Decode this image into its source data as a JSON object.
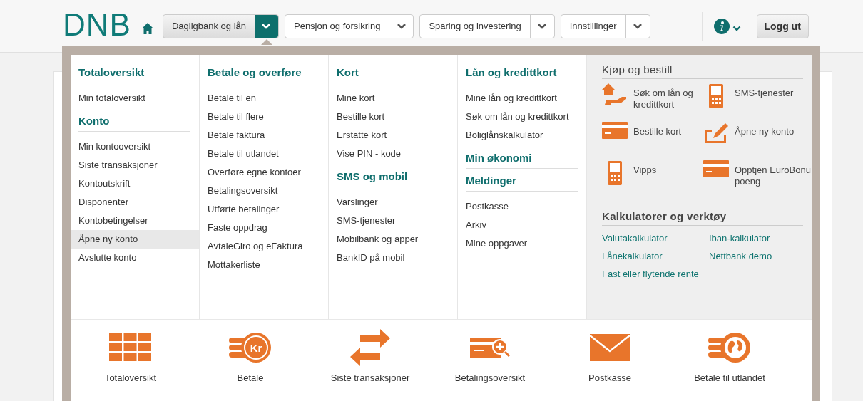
{
  "header": {
    "logo": "DNB",
    "nav": [
      {
        "label": "Dagligbank og lån",
        "selected": true
      },
      {
        "label": "Pensjon og forsikring",
        "selected": false
      },
      {
        "label": "Sparing og investering",
        "selected": false
      },
      {
        "label": "Innstillinger",
        "selected": false
      }
    ],
    "logout": "Logg ut"
  },
  "menu": {
    "columns": [
      [
        {
          "heading": "Totaloversikt",
          "items": [
            {
              "label": "Min totaloversikt",
              "selected": false
            }
          ]
        },
        {
          "heading": "Konto",
          "items": [
            {
              "label": "Min kontooversikt",
              "selected": false
            },
            {
              "label": "Siste transaksjoner",
              "selected": false
            },
            {
              "label": "Kontoutskrift",
              "selected": false
            },
            {
              "label": "Disponenter",
              "selected": false
            },
            {
              "label": "Kontobetingelser",
              "selected": false
            },
            {
              "label": "Åpne ny konto",
              "selected": true
            },
            {
              "label": "Avslutte konto",
              "selected": false
            }
          ]
        }
      ],
      [
        {
          "heading": "Betale og overføre",
          "items": [
            {
              "label": "Betale til en",
              "selected": false
            },
            {
              "label": "Betale til flere",
              "selected": false
            },
            {
              "label": "Betale faktura",
              "selected": false
            },
            {
              "label": "Betale til utlandet",
              "selected": false
            },
            {
              "label": "Overføre egne kontoer",
              "selected": false
            },
            {
              "label": "Betalingsoversikt",
              "selected": false
            },
            {
              "label": "Utførte betalinger",
              "selected": false
            },
            {
              "label": "Faste oppdrag",
              "selected": false
            },
            {
              "label": "AvtaleGiro og eFaktura",
              "selected": false
            },
            {
              "label": "Mottakerliste",
              "selected": false
            }
          ]
        }
      ],
      [
        {
          "heading": "Kort",
          "items": [
            {
              "label": "Mine kort",
              "selected": false
            },
            {
              "label": "Bestille kort",
              "selected": false
            },
            {
              "label": "Erstatte kort",
              "selected": false
            },
            {
              "label": "Vise PIN - kode",
              "selected": false
            }
          ]
        },
        {
          "heading": "SMS og mobil",
          "items": [
            {
              "label": "Varslinger",
              "selected": false
            },
            {
              "label": "SMS-tjenester",
              "selected": false
            },
            {
              "label": "Mobilbank og apper",
              "selected": false
            },
            {
              "label": "BankID på mobil",
              "selected": false
            }
          ]
        }
      ],
      [
        {
          "heading": "Lån og kredittkort",
          "items": [
            {
              "label": "Mine lån og kredittkort",
              "selected": false
            },
            {
              "label": "Søk om lån og kredittkort",
              "selected": false
            },
            {
              "label": "Boliglånskalkulator",
              "selected": false
            }
          ]
        },
        {
          "heading": "Min økonomi"
        },
        {
          "heading": "Meldinger",
          "items": [
            {
              "label": "Postkasse",
              "selected": false
            },
            {
              "label": "Arkiv",
              "selected": false
            },
            {
              "label": "Mine oppgaver",
              "selected": false
            }
          ]
        }
      ]
    ],
    "shop": {
      "heading": "Kjøp og bestill",
      "items": [
        {
          "kind": "house",
          "label": "Søk om lån og kredittkort"
        },
        {
          "kind": "phone",
          "label": "SMS-tjenester"
        },
        {
          "kind": "card",
          "label": "Bestille kort"
        },
        {
          "kind": "pen",
          "label": "Åpne ny konto"
        },
        {
          "kind": "phone",
          "label": "Vipps"
        },
        {
          "kind": "card",
          "label": "Opptjen EuroBonu poeng"
        }
      ]
    },
    "tools": {
      "heading": "Kalkulatorer og verktøy",
      "links": [
        "Valutakalkulator",
        "Iban-kalkulator",
        "Lånekalkulator",
        "Nettbank demo",
        "Fast eller flytende rente"
      ]
    }
  },
  "shortcuts": [
    {
      "kind": "grid",
      "label": "Totaloversikt"
    },
    {
      "kind": "coins",
      "icon_text": "Kr",
      "label": "Betale"
    },
    {
      "kind": "arrows",
      "label": "Siste transaksjoner"
    },
    {
      "kind": "magnifier",
      "label": "Betalingsoversikt"
    },
    {
      "kind": "envelope",
      "label": "Postkasse"
    },
    {
      "kind": "globe",
      "label": "Betale til utlandet"
    }
  ]
}
